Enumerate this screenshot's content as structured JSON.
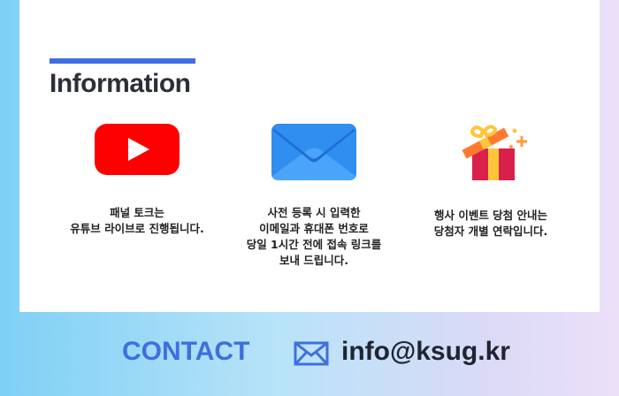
{
  "info": {
    "title": "Information",
    "items": [
      {
        "icon": "youtube-icon",
        "text": "패널 토크는\n유튜브 라이브로 진행됩니다."
      },
      {
        "icon": "envelope-icon",
        "text": "사전 등록 시 입력한\n이메일과 휴대폰 번호로\n당일 1시간 전에 접속 링크를\n보내 드립니다."
      },
      {
        "icon": "gift-box-icon",
        "text": "행사 이벤트 당첨 안내는\n당첨자 개별 연락입니다."
      }
    ]
  },
  "contact": {
    "label": "CONTACT",
    "icon": "mail-icon",
    "email": "info@ksug.kr"
  },
  "colors": {
    "accent": "#3d6fe0",
    "youtube_red": "#ff0000",
    "envelope_blue": "#2f8ef0"
  }
}
